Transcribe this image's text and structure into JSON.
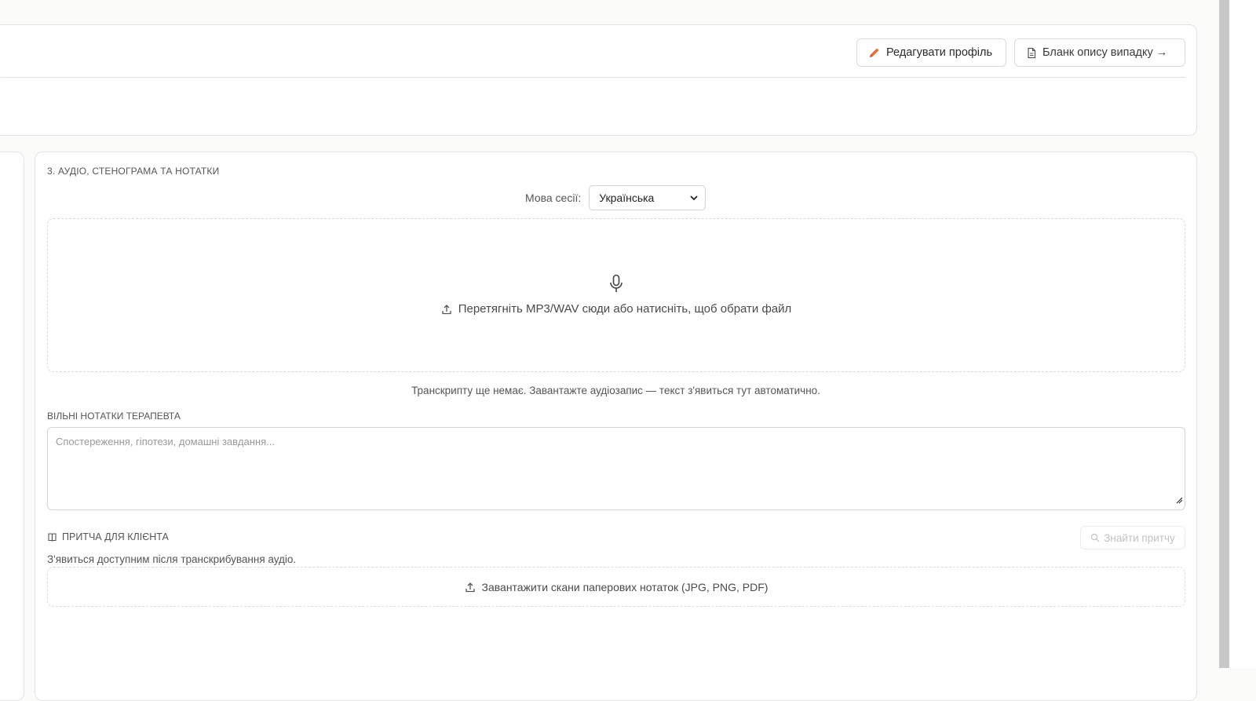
{
  "header": {
    "edit_profile_label": "Редагувати профіль",
    "case_form_label": "Бланк опису випадку →"
  },
  "section": {
    "title": "3. АУДІО, СТЕНОГРАМА ТА НОТАТКИ",
    "language_label": "Мова сесії:",
    "language_value": "Українська",
    "dropzone_text": "Перетягніть MP3/WAV сюди або натисніть, щоб обрати файл",
    "transcript_empty": "Транскрипту ще немає. Завантажте аудіозапис — текст з'явиться тут автоматично.",
    "notes_label": "ВІЛЬНІ НОТАТКИ ТЕРАПЕВТА",
    "notes_placeholder": "Спостереження, гіпотези, домашні завдання...",
    "parable_label": "ПРИТЧА ДЛЯ КЛІЄНТА",
    "find_parable_label": "Знайти притчу",
    "parable_hint": "З'явиться доступним після транскрибування аудіо.",
    "scan_upload_label": "Завантажити скани паперових нотаток (JPG, PNG, PDF)"
  },
  "icons": {
    "edit": "pencil-icon",
    "case_form": "document-icon",
    "select": "chevron-down-icon",
    "mic": "microphone-icon",
    "upload": "upload-icon",
    "parable": "book-icon",
    "search": "search-icon"
  },
  "colors": {
    "accent": "#e8703a",
    "border": "#e3e3e3",
    "muted_text": "#555555"
  }
}
